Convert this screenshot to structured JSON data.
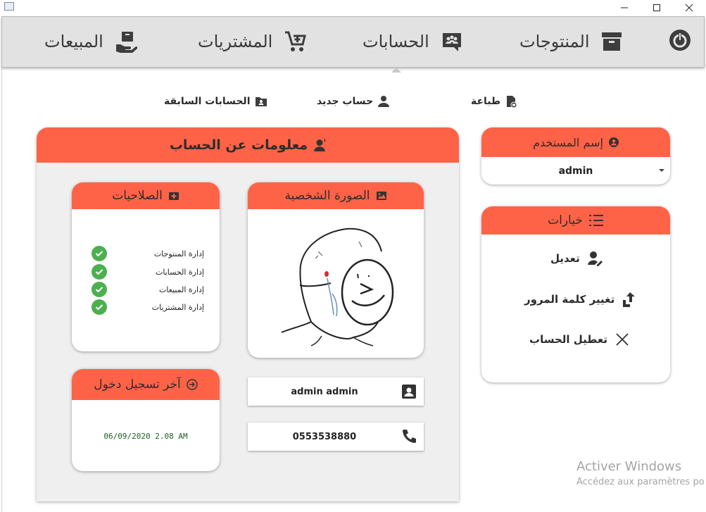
{
  "window": {
    "min": "—",
    "max": "☐",
    "close": "✕"
  },
  "menu": {
    "sales": "المبيعات",
    "purchases": "المشتريات",
    "accounts": "الحسابات",
    "products": "المنتوجات"
  },
  "submenu": {
    "previous_accounts": "الحسابات السابقة",
    "new_account": "حساب جديد",
    "print": "طباعة"
  },
  "account_info": {
    "title": "معلومات عن الحساب",
    "permissions_title": "الصلاحيات",
    "permissions": [
      "إدارة المنتوجات",
      "إدارة الحسابات",
      "إدارة المبيعات",
      "إدارة المشتريات"
    ],
    "profile_title": "الصورة الشخصية",
    "last_login_title": "آخر تسجيل دخول",
    "last_login_value": "06/09/2020 2.08 AM",
    "full_name": "admin admin",
    "phone": "0553538880"
  },
  "username": {
    "title": "إسم المستخدم",
    "selected": "admin"
  },
  "options": {
    "title": "خيارات",
    "edit": "تعديل",
    "change_password": "تغيير كلمة المرور",
    "disable_account": "تعطيل الحساب"
  },
  "watermark": {
    "line1": "Activer Windows",
    "line2": "Accédez aux paramètres po"
  },
  "colors": {
    "accent": "#ff6347",
    "check": "#4caf50",
    "menu_bg": "#e2e2e2"
  }
}
